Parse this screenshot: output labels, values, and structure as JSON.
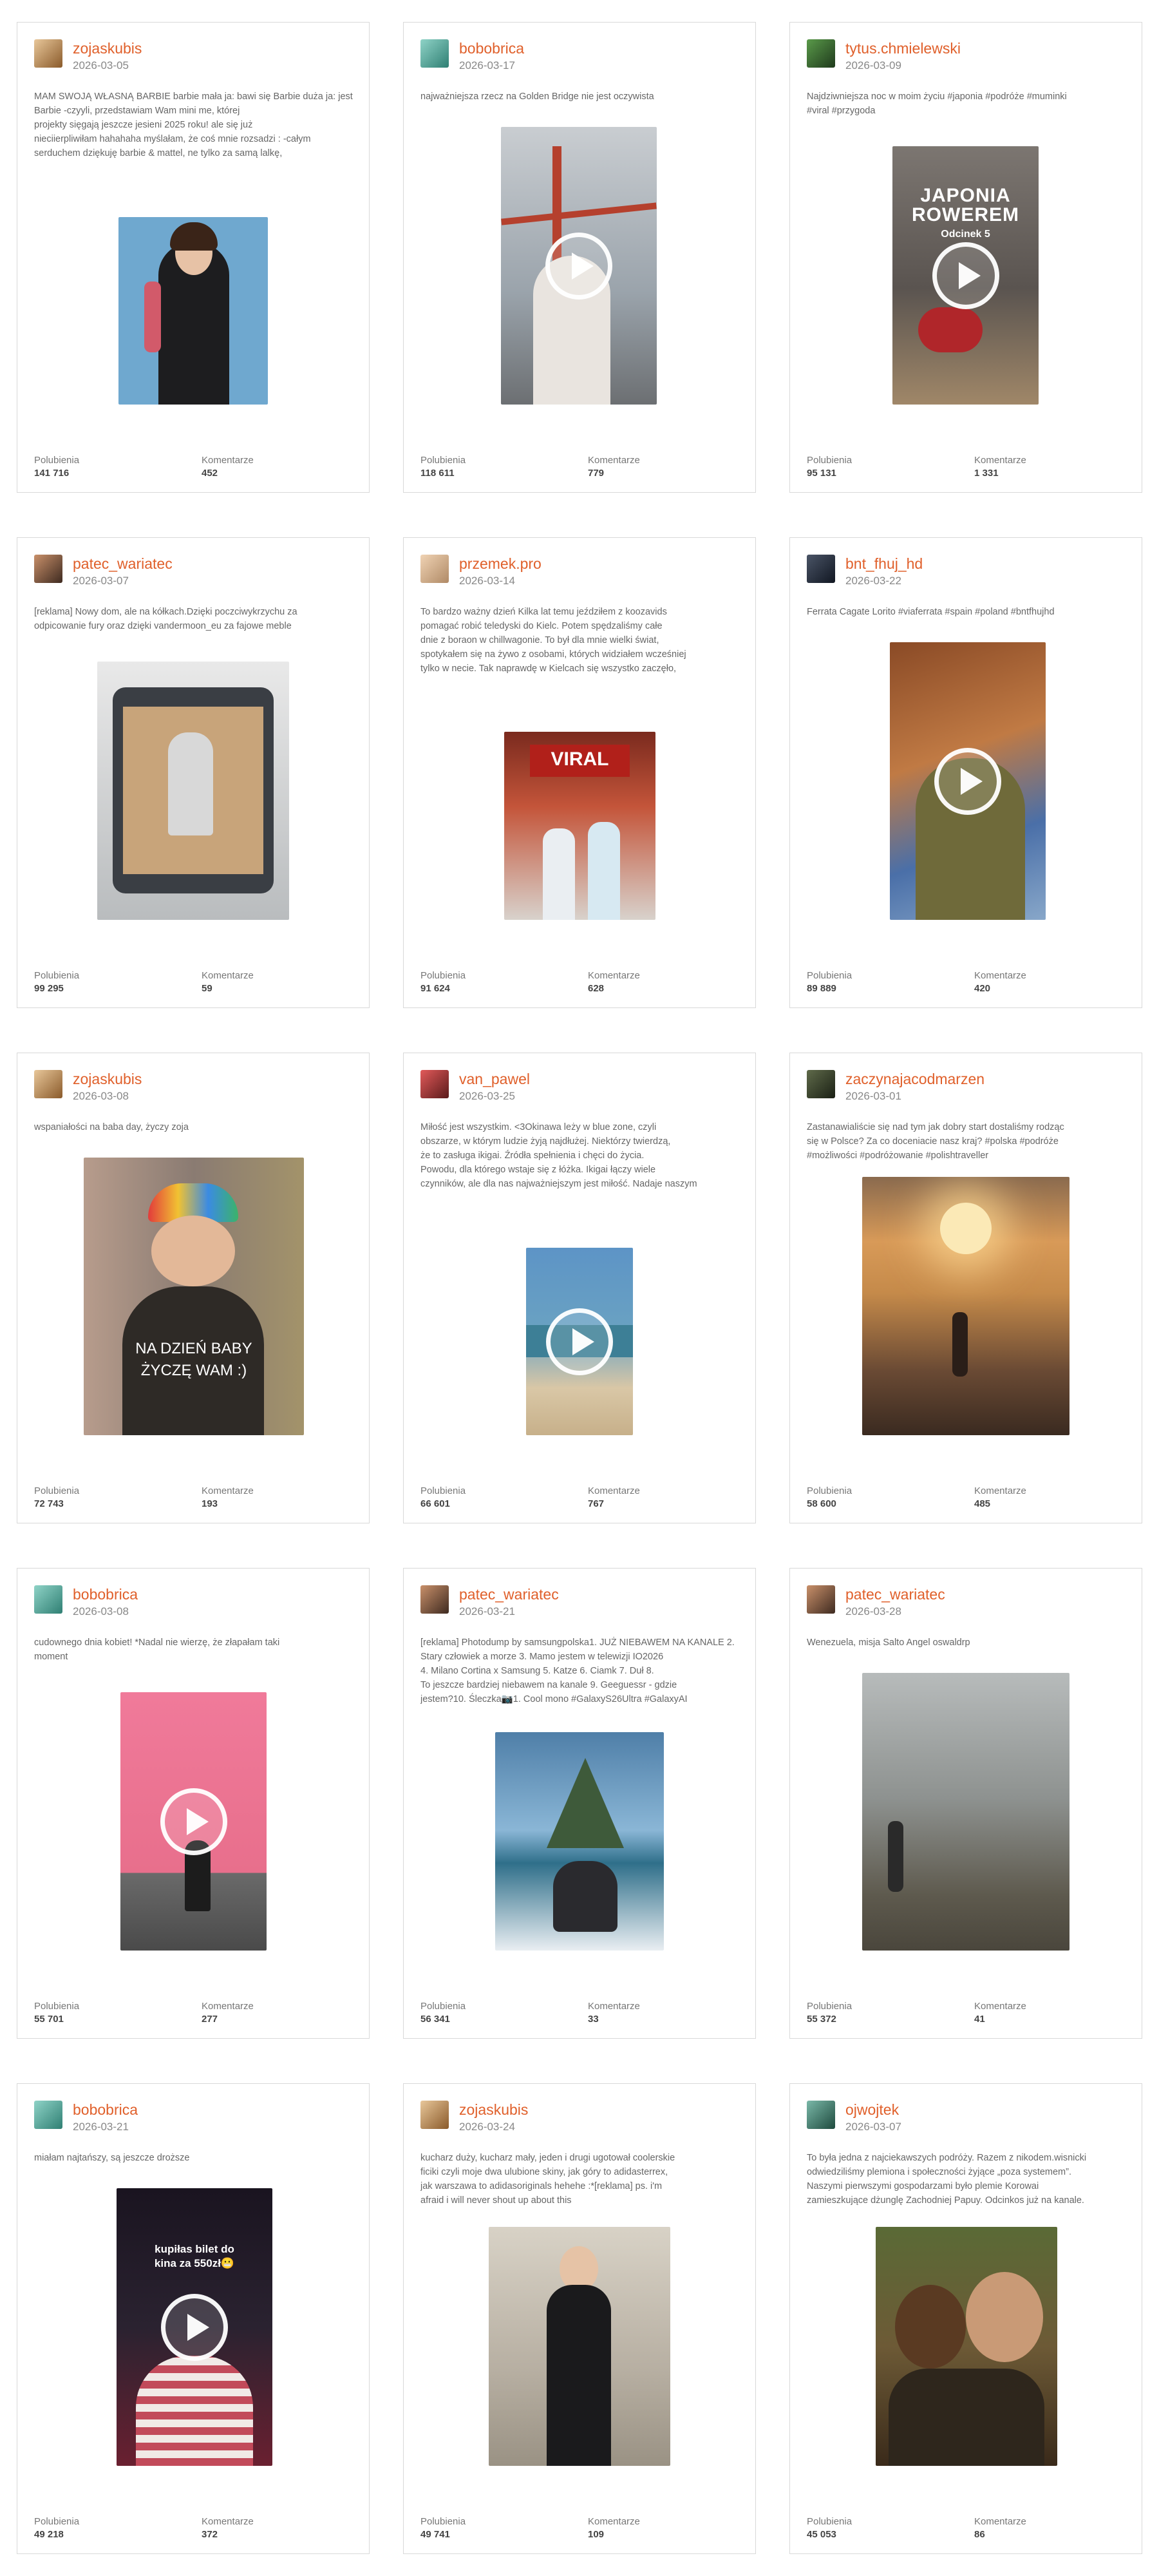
{
  "labels": {
    "likes": "Polubienia",
    "comments": "Komentarze"
  },
  "posts": [
    {
      "user": "zojaskubis",
      "date": "2026-03-05",
      "caption": "MAM SWOJĄ WŁASNĄ BARBIE barbie mała ja: bawi się Barbie  duża ja: jest Barbie -czyyli, przedstawiam Wam mini me, której\nprojekty sięgają jeszcze jesieni 2025 roku! ale się już\nnieciierpliwiłam hahahaha myślałam, że coś mnie rozsadzi : -całym\nserduchem dziękuję barbie & mattel, ne tylko za samą lalkę,\nale przede wszystkim, zwiazany z nią tytuł „Role Model” mam\nnadzieję, że w 2026 roku też uda mi się dowieść kilka równie...",
      "likes": "141 716",
      "comments": "452",
      "media": "image",
      "avatar_color": "#c79a5a",
      "media_color": "#6fa8cf"
    },
    {
      "user": "bobobrica",
      "date": "2026-03-17",
      "caption": "najważniejsza rzecz na Golden Bridge nie jest oczywista",
      "likes": "118 611",
      "comments": "779",
      "media": "video",
      "avatar_color": "#5fb6a8",
      "media_color": "#9aa3ab"
    },
    {
      "user": "tytus.chmielewski",
      "date": "2026-03-09",
      "caption": "Najdziwniejsza noc w moim życiu #japonia #podróże #muminki\n#viral #przygoda",
      "likes": "95 131",
      "comments": "1 331",
      "media": "video",
      "avatar_color": "#3f7a3a",
      "media_color": "#6d6a66",
      "overlay": "JAPONIA ROWEREM",
      "overlay_sub": "Odcinek 5"
    },
    {
      "user": "patec_wariatec",
      "date": "2026-03-07",
      "caption": "[reklama] Nowy dom, ale na kółkach.Dzięki poczciwykrzychu za\nodpicowanie fury oraz dzięki vandermoon_eu za fajowe meble",
      "likes": "99 295",
      "comments": "59",
      "media": "image",
      "avatar_color": "#6b4a3a",
      "media_color": "#b9bcbe"
    },
    {
      "user": "przemek.pro",
      "date": "2026-03-14",
      "caption": "To bardzo ważny dzień Kilka lat temu jeździłem z koozavids\npomagać robić teledyski do Kielc. Potem spędzaliśmy całe\ndnie z boraon w chillwagonie. To był dla mnie wielki świat,\nspotykałem się na żywo z osobami, których widziałem wcześniej\ntylko w necie. Tak naprawdę w Kielcach się wszystko zaczęło,\nbo od chillwagonu potem robiłem zdjęcia na praktycznie każdym\nteledysku Kozy. Działaliśmy wtedy z największymi raperami i...",
      "likes": "91 624",
      "comments": "628",
      "media": "image",
      "avatar_color": "#d8b48e",
      "media_color": "#c4553a",
      "overlay": "VIRAL"
    },
    {
      "user": "bnt_fhuj_hd",
      "date": "2026-03-22",
      "caption": "Ferrata Cagate Lorito #viaferrata #spain #poland #bntfhujhd",
      "likes": "89 889",
      "comments": "420",
      "media": "video",
      "avatar_color": "#2a3140",
      "media_color": "#b26a3a"
    },
    {
      "user": "zojaskubis",
      "date": "2026-03-08",
      "caption": "wspaniałości na baba day, życzy zoja",
      "likes": "72 743",
      "comments": "193",
      "media": "image",
      "avatar_color": "#c79a5a",
      "media_color": "#8a7b72",
      "overlay": "NA DZIEŃ BABY\nŻYCZĘ WAM :)"
    },
    {
      "user": "van_pawel",
      "date": "2026-03-25",
      "caption": "Miłość jest wszystkim. <3Okinawa leży w blue zone, czyli\nobszarze, w którym ludzie żyją najdłużej. Niektórzy twierdzą,\nże to zasługa ikigai. Źródła spełnienia i chęci do życia.\nPowodu, dla którego wstaje się z łóżka. Ikigai łączy wiele\nczynników, ale dla nas najważniejszym jest miłość. Nadaje naszym\nżyciom wartość i pomaga nam w dążeniu do spełnienia.Dlatego na\nzaręczyny wybrałem Okinawę, aby nasza wspólna przyszłość trwała...",
      "likes": "66 601",
      "comments": "767",
      "media": "video",
      "avatar_color": "#b23a3a",
      "media_color": "#6aa2c2"
    },
    {
      "user": "zaczynajacodmarzen",
      "date": "2026-03-01",
      "caption": "Zastanawialiście się nad tym jak dobry start dostaliśmy rodząc\nsię w Polsce? Za co doceniacie nasz kraj? #polska #podróże\n#możliwości #podróżowanie #polishtraveller",
      "likes": "58 600",
      "comments": "485",
      "media": "image",
      "avatar_color": "#2f3a2a",
      "media_color": "#c58a4a"
    },
    {
      "user": "bobobrica",
      "date": "2026-03-08",
      "caption": "cudownego dnia kobiet! *Nadal nie wierzę, że złapałam taki\nmoment",
      "likes": "55 701",
      "comments": "277",
      "media": "video",
      "avatar_color": "#5fb6a8",
      "media_color": "#e86f8c"
    },
    {
      "user": "patec_wariatec",
      "date": "2026-03-21",
      "caption": "[reklama] Photodump by samsungpolska1. JUŻ NIEBAWEM NA KANALE 2.\nStary człowiek a morze  3. Mamo jestem w telewizji IO2026\n 4. Milano Cortina x Samsung  5. Katze  6. Ciamk 7. Duł 8.\nTo jeszcze bardziej niebawem na kanale  9. Geeguessr - gdzie\njestem?10. Śleczka📷1. Cool mono #GalaxyS26Ultra #GalaxyAI",
      "likes": "56 341",
      "comments": "33",
      "media": "image",
      "avatar_color": "#6b4a3a",
      "media_color": "#4f7fa8"
    },
    {
      "user": "patec_wariatec",
      "date": "2026-03-28",
      "caption": "Wenezuela, misja Salto Angel oswaldrp",
      "likes": "55 372",
      "comments": "41",
      "media": "image",
      "avatar_color": "#6b4a3a",
      "media_color": "#8e9290"
    },
    {
      "user": "bobobrica",
      "date": "2026-03-21",
      "caption": "miałam najtańszy, są jeszcze droższe",
      "likes": "49 218",
      "comments": "372",
      "media": "video",
      "avatar_color": "#5fb6a8",
      "media_color": "#2a2230",
      "overlay": "kupiłas bilet do kina za 550zł😬"
    },
    {
      "user": "zojaskubis",
      "date": "2026-03-24",
      "caption": "kucharz duży, kucharz mały, jeden i drugi ugotował coolerskie\nficiki czyli moje dwa ulubione skiny, jak góry to adidasterrex,\njak warszawa to adidasoriginals hehehe :*[reklama] ps. i'm\nafraid i will never shout up about this",
      "likes": "49 741",
      "comments": "109",
      "media": "image",
      "avatar_color": "#c79a5a",
      "media_color": "#b7afa2"
    },
    {
      "user": "ojwojtek",
      "date": "2026-03-07",
      "caption": "To była jedna z najciekawszych podróży. Razem z nikodem.wisnicki\nodwiedziliśmy plemiona i społeczności żyjące „poza systemem”.\nNaszymi pierwszymi gospodarzami było plemie Korowai\nzamieszkujące dżunglę Zachodniej Papuy. Odcinkos już na kanale.",
      "likes": "45 053",
      "comments": "86",
      "media": "image",
      "avatar_color": "#3e7a6a",
      "media_color": "#6d5a36"
    }
  ]
}
